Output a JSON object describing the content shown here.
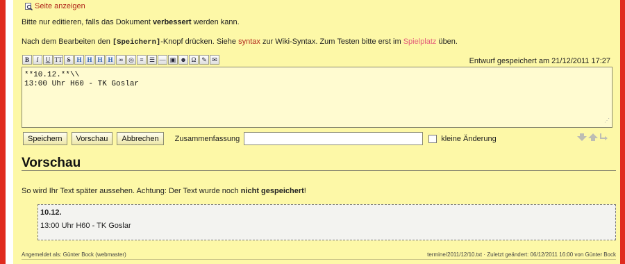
{
  "show_page": {
    "label": "Seite anzeigen",
    "icon": "magnifier-icon"
  },
  "intro": {
    "line1_prefix": "Bitte nur editieren, falls das Dokument ",
    "line1_bold": "verbessert",
    "line1_suffix": " werden kann.",
    "line2_prefix": "Nach dem Bearbeiten den ",
    "line2_code": "[Speichern]",
    "line2_mid": "-Knopf drücken. Siehe ",
    "line2_link_syntax": "syntax",
    "line2_mid2": " zur Wiki-Syntax. Zum Testen bitte erst im ",
    "line2_link_playground": "Spielplatz",
    "line2_suffix": " üben."
  },
  "toolbar": {
    "buttons": [
      {
        "name": "bold",
        "glyph": "B"
      },
      {
        "name": "italic",
        "glyph": "I"
      },
      {
        "name": "underline",
        "glyph": "U"
      },
      {
        "name": "monospace",
        "glyph": "TT"
      },
      {
        "name": "strikethrough",
        "glyph": "S"
      },
      {
        "name": "heading-same",
        "glyph": "H"
      },
      {
        "name": "heading-lower",
        "glyph": "H"
      },
      {
        "name": "heading-higher",
        "glyph": "H"
      },
      {
        "name": "heading-menu",
        "glyph": "H"
      },
      {
        "name": "internal-link",
        "glyph": "∞"
      },
      {
        "name": "external-link",
        "glyph": "◎"
      },
      {
        "name": "ordered-list",
        "glyph": "≡"
      },
      {
        "name": "unordered-list",
        "glyph": "☰"
      },
      {
        "name": "horizontal-rule",
        "glyph": "—"
      },
      {
        "name": "image",
        "glyph": "▣"
      },
      {
        "name": "smiley",
        "glyph": "☻"
      },
      {
        "name": "special-chars",
        "glyph": "Ω"
      },
      {
        "name": "signature",
        "glyph": "✎"
      },
      {
        "name": "media",
        "glyph": "✉"
      }
    ]
  },
  "draft_status": "Entwurf gespeichert am 21/12/2011 17:27",
  "editor": {
    "line1": "**10.12.**\\\\",
    "line2": "13:00 Uhr H60 - TK Goslar"
  },
  "actions": {
    "save": "Speichern",
    "preview": "Vorschau",
    "cancel": "Abbrechen",
    "summary_label": "Zusammenfassung",
    "summary_value": "",
    "minor_change": "kleine Änderung"
  },
  "preview": {
    "heading": "Vorschau",
    "note_prefix": "So wird Ihr Text später aussehen. Achtung: Der Text wurde noch ",
    "note_bold": "nicht gespeichert",
    "note_suffix": "!",
    "content_bold": "10.12.",
    "content_text": "13:00 Uhr H60 - TK Goslar"
  },
  "footer": {
    "left": "Angemeldet als: Günter Bock (webmaster)",
    "right": "termine/2011/12/10.txt · Zuletzt geändert: 06/12/2011 16:00 von Günter Bock"
  },
  "colors": {
    "frame": "#e02b1e",
    "background": "#fdf8a7",
    "link": "#b0251a",
    "link_new": "#e35b7a"
  }
}
